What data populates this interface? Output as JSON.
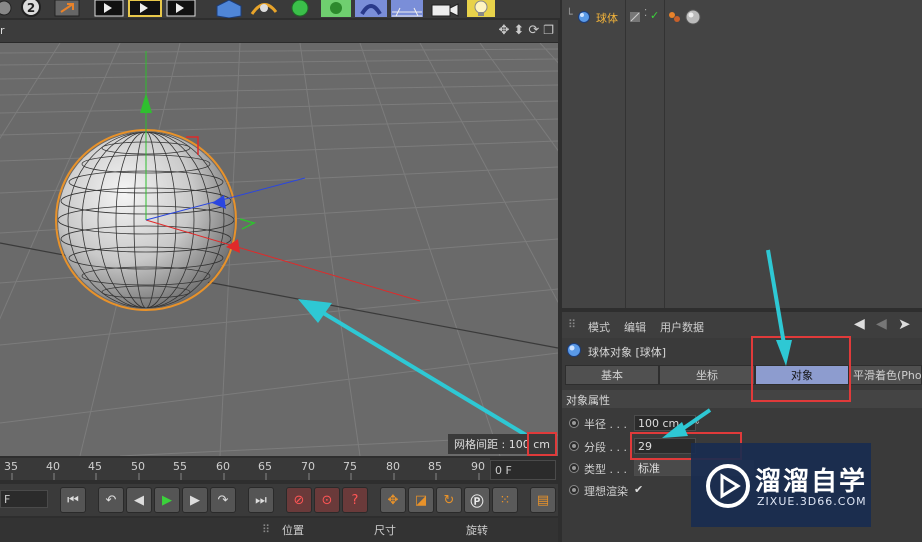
{
  "viewport": {
    "header_tail": "r",
    "grid_spacing_label": "网格间距 : 100 cm"
  },
  "timeline": {
    "ticks": [
      "35",
      "40",
      "45",
      "50",
      "55",
      "60",
      "65",
      "70",
      "75",
      "80",
      "85",
      "90"
    ],
    "current_frame": "0 F",
    "left_frame": "F"
  },
  "bottom_bar": {
    "col1": "位置",
    "col2": "尺寸",
    "col3": "旋转"
  },
  "object_manager": {
    "object_name": "球体"
  },
  "attributes": {
    "menu": [
      "模式",
      "编辑",
      "用户数据"
    ],
    "object_title": "球体对象 [球体]",
    "tabs": [
      "基本",
      "坐标",
      "对象",
      "平滑着色(Pho"
    ],
    "active_tab": "对象",
    "section_title": "对象属性",
    "props": {
      "radius_label": "半径 . . .",
      "radius_value": "100 cm",
      "segments_label": "分段 . . .",
      "segments_value": "29",
      "type_label": "类型 . . .",
      "type_value": "标准",
      "render_label": "理想渲染",
      "render_check": "✔"
    }
  },
  "watermark": {
    "title": "溜溜自学",
    "url": "ZIXUE.3D66.COM"
  },
  "colors": {
    "accent_active_tab": "#8d9ccf",
    "callout_red": "#e03a3a",
    "arrow_cyan": "#2ec8d4",
    "axis_y": "#2fbf2f",
    "axis_x": "#e02a2a",
    "axis_z": "#2a46e0"
  }
}
